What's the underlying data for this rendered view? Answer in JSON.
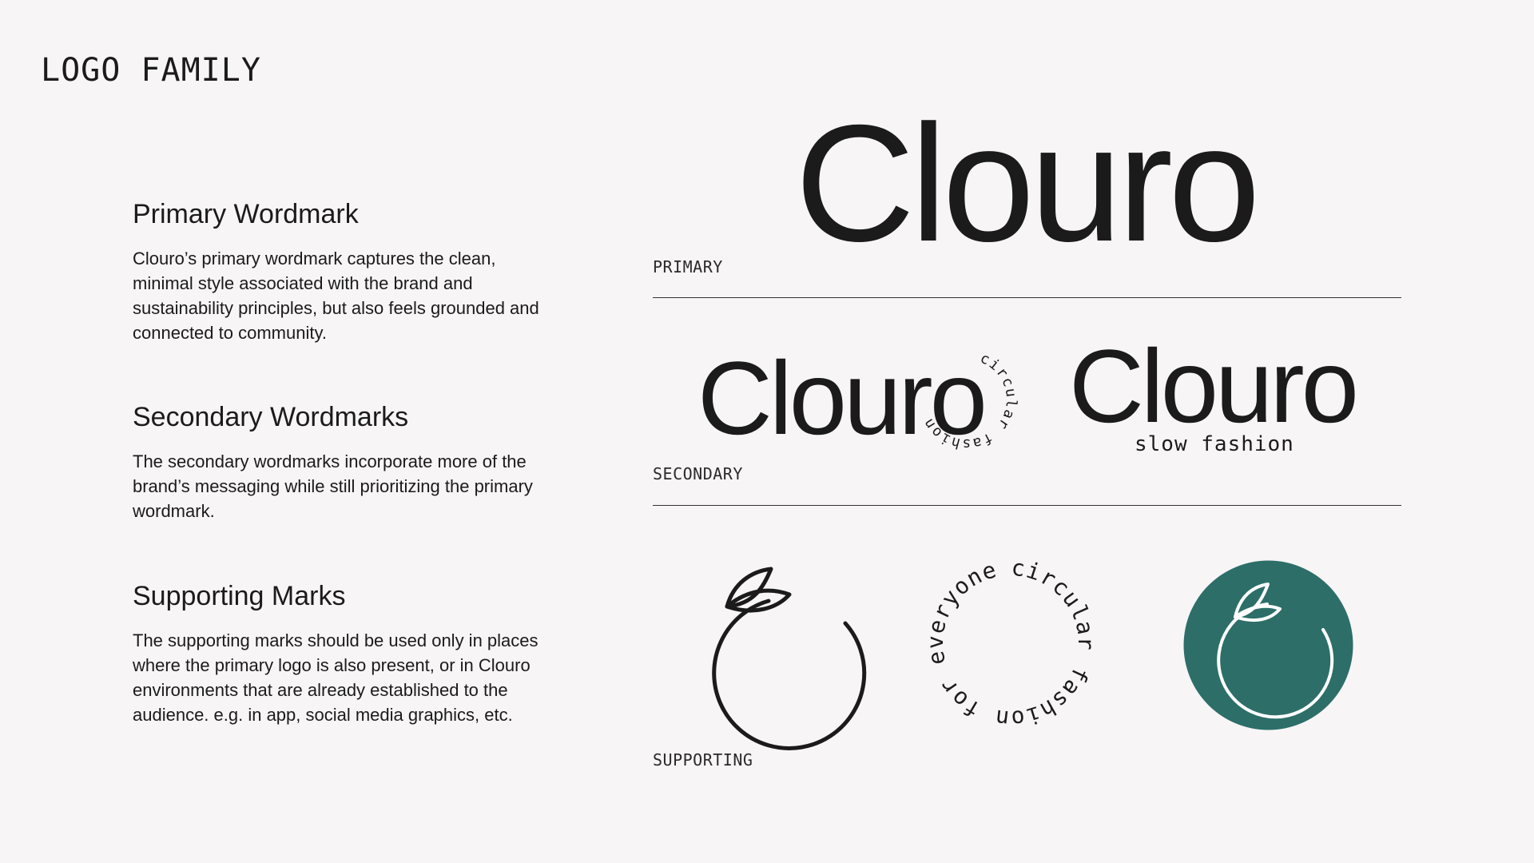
{
  "page": {
    "title": "LOGO FAMILY"
  },
  "sections": {
    "primary": {
      "heading": "Primary Wordmark",
      "body": "Clouro’s primary wordmark captures the clean, minimal style associated with the brand and sustainability principles, but also feels grounded and connected to community."
    },
    "secondary": {
      "heading": "Secondary Wordmarks",
      "body": "The secondary wordmarks incorporate more of the brand’s messaging while still prioritizing the primary wordmark."
    },
    "supporting": {
      "heading": "Supporting Marks",
      "body": "The supporting marks should be used only in places where the primary logo is also present, or in Clouro environments that are already established to the audience. e.g. in app,  social media graphics, etc."
    }
  },
  "rows": {
    "primary_label": "PRIMARY",
    "secondary_label": "SECONDARY",
    "supporting_label": "SUPPORTING"
  },
  "logos": {
    "wordmark": "Clouro",
    "badge_text": "circular fashion",
    "tagline": "slow fashion",
    "ring_text": "circular fashion for everyone"
  },
  "colors": {
    "background": "#f7f5f6",
    "ink": "#1b1b1b",
    "brand_green": "#2d6e69",
    "mark_on_green": "#ffffff"
  },
  "icons": {
    "supporting_mark": "fruit-leaf-icon",
    "supporting_mark_filled": "fruit-leaf-badge-icon"
  }
}
